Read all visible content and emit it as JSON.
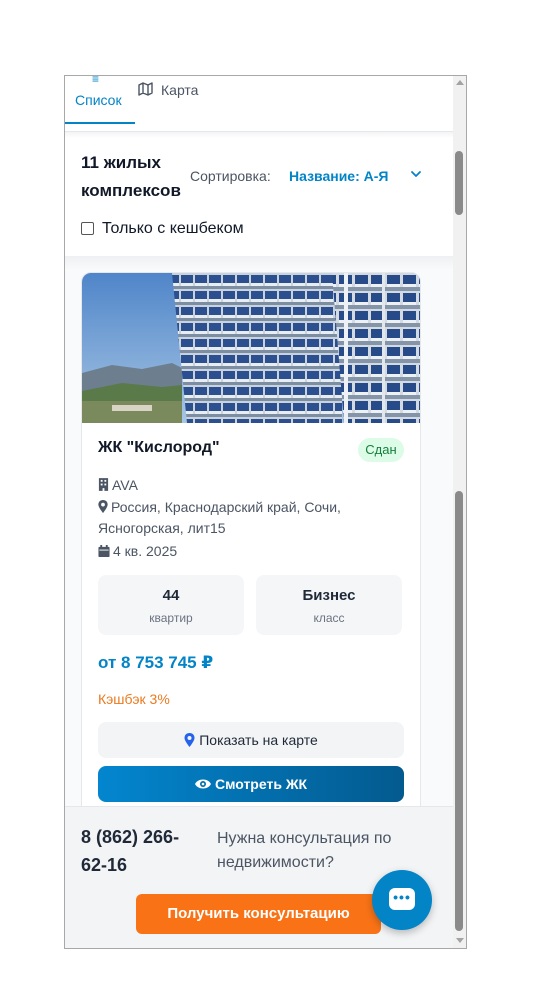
{
  "tabs": {
    "list": {
      "label": "Список",
      "icon": "list-icon"
    },
    "map": {
      "label": "Карта",
      "icon": "map-icon"
    }
  },
  "header": {
    "results_count": "11 жилых комплексов",
    "sort_label": "Сортировка:",
    "sort_value": "Название: А-Я",
    "cashback_filter": {
      "label": "Только с кешбеком",
      "checked": false
    }
  },
  "card": {
    "title": "ЖК \"Кислород\"",
    "status": "Сдан",
    "developer": "AVA",
    "address": "Россия, Краснодарский край, Сочи, Ясногорская, лит15",
    "completion": "4 кв. 2025",
    "stats": [
      {
        "value": "44",
        "caption": "квартир"
      },
      {
        "value": "Бизнес",
        "caption": "класс"
      }
    ],
    "price": "от 8 753 745 ₽",
    "cashback": "Кэшбэк 3%",
    "map_button": "Показать на карте",
    "view_button": "Смотреть ЖК"
  },
  "bottom": {
    "phone": "8 (862) 266-62-16",
    "consult_text": "Нужна консультация по недвижимости?",
    "consult_button": "Получить консультацию"
  },
  "colors": {
    "accent": "#0284c7",
    "orange": "#f97316",
    "badge_bg": "#dcfce7",
    "badge_text": "#15803d",
    "cashback": "#ea7a1f"
  }
}
